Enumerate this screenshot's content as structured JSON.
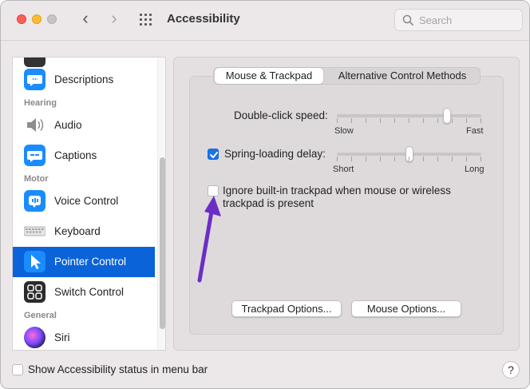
{
  "window": {
    "title": "Accessibility",
    "search_placeholder": "Search"
  },
  "sidebar": {
    "items": [
      {
        "label": "Descriptions",
        "icon": "descriptions-icon",
        "color": "#1a8cff"
      },
      {
        "label": "Audio",
        "icon": "speaker-icon",
        "color": "#8e8e8e"
      },
      {
        "label": "Captions",
        "icon": "captions-icon",
        "color": "#1a8cff"
      },
      {
        "label": "Voice Control",
        "icon": "voice-control-icon",
        "color": "#1a8cff"
      },
      {
        "label": "Keyboard",
        "icon": "keyboard-icon",
        "color": "#b0b0b0"
      },
      {
        "label": "Pointer Control",
        "icon": "pointer-icon",
        "color": "#1a8cff"
      },
      {
        "label": "Switch Control",
        "icon": "switch-control-icon",
        "color": "#333333"
      },
      {
        "label": "Siri",
        "icon": "siri-icon",
        "color": "#6a3fd8"
      }
    ],
    "headers": {
      "hearing": "Hearing",
      "motor": "Motor",
      "general": "General"
    },
    "selected": "Pointer Control"
  },
  "tabs": {
    "active": "Mouse & Trackpad",
    "inactive": "Alternative Control Methods"
  },
  "settings": {
    "double_click": {
      "label": "Double-click speed:",
      "min_label": "Slow",
      "max_label": "Fast",
      "value_fraction": 0.76
    },
    "spring_loading": {
      "label": "Spring-loading delay:",
      "checked": true,
      "min_label": "Short",
      "max_label": "Long",
      "value_fraction": 0.5
    },
    "ignore_trackpad": {
      "label_line1": "Ignore built-in trackpad when mouse or wireless",
      "label_line2": "trackpad is present",
      "checked": false
    }
  },
  "buttons": {
    "trackpad_options": "Trackpad Options...",
    "mouse_options": "Mouse Options..."
  },
  "footer": {
    "status_label": "Show Accessibility status in menu bar",
    "status_checked": false,
    "help": "?"
  },
  "colors": {
    "accent": "#0a63d8",
    "annotation_arrow": "#6c2dc7"
  }
}
